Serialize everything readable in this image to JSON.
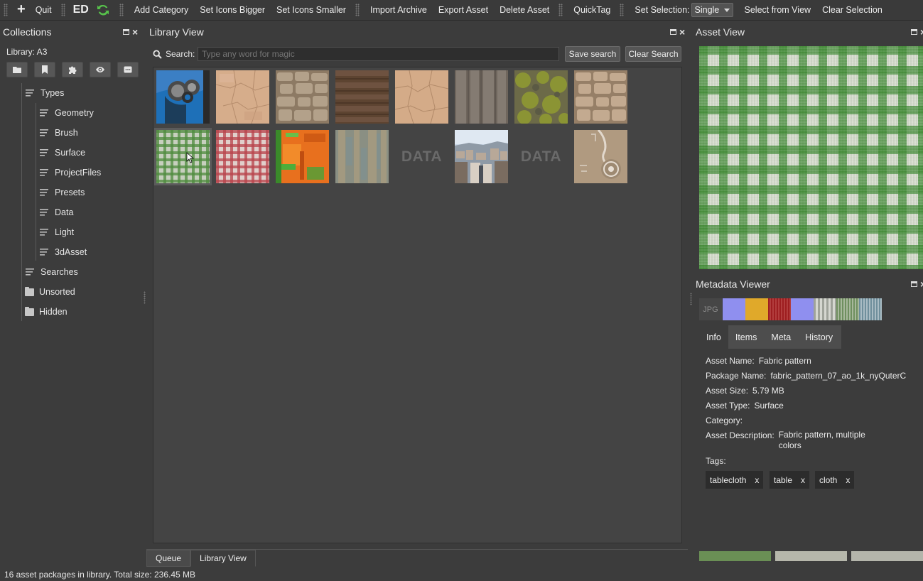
{
  "toolbar": {
    "quit": "Quit",
    "ed": "ED",
    "add_category": "Add Category",
    "set_icons_bigger": "Set Icons Bigger",
    "set_icons_smaller": "Set Icons Smaller",
    "import_archive": "Import Archive",
    "export_asset": "Export Asset",
    "delete_asset": "Delete Asset",
    "quicktag": "QuickTag",
    "set_selection_label": "Set Selection:",
    "set_selection_value": "Single",
    "select_from_view": "Select from View",
    "clear_selection": "Clear Selection"
  },
  "collections": {
    "title": "Collections",
    "library": "Library: A3",
    "tree": {
      "types": "Types",
      "children": [
        "Geometry",
        "Brush",
        "Surface",
        "ProjectFiles",
        "Presets",
        "Data",
        "Light",
        "3dAsset"
      ],
      "searches": "Searches",
      "unsorted": "Unsorted",
      "hidden": "Hidden"
    }
  },
  "library_view": {
    "title": "Library View",
    "search_label": "Search:",
    "search_placeholder": "Type any word for magic",
    "save_search": "Save search",
    "clear_search": "Clear Search",
    "data_tile_label": "DATA",
    "tabs": [
      "Queue",
      "Library View"
    ],
    "status": "16 asset packages in library. Total size: 236.45 MB"
  },
  "asset_view": {
    "title": "Asset View"
  },
  "metadata_viewer": {
    "title": "Metadata Viewer",
    "format": "JPG",
    "swatch_colors": [
      "#8f8fef",
      "#e0a92a",
      "#c9585a",
      "#8f8fef",
      "#b9bdb6",
      "#7f9a72",
      "#7f99a6"
    ],
    "tabs": [
      "Info",
      "Items",
      "Meta",
      "History"
    ],
    "info": {
      "asset_name_label": "Asset Name:",
      "asset_name": "Fabric pattern",
      "package_name_label": "Package Name:",
      "package_name": "fabric_pattern_07_ao_1k_nyQuterC",
      "asset_size_label": "Asset Size:",
      "asset_size": "5.79 MB",
      "asset_type_label": "Asset Type:",
      "asset_type": "Surface",
      "category_label": "Category:",
      "category": "",
      "description_label": "Asset Description:",
      "description_line1": "Fabric pattern, multiple",
      "description_line2": "colors",
      "tags_label": "Tags:"
    },
    "tags": [
      "tablecloth",
      "table",
      "cloth"
    ],
    "tag_remove": "x",
    "bottom_bar_colors": [
      "#6a8f55",
      "#b6b7ab",
      "#b4b5ab"
    ]
  }
}
